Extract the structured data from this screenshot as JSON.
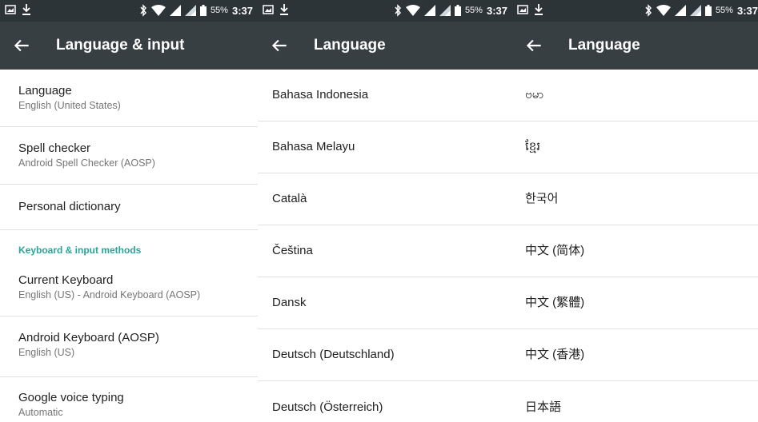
{
  "status": {
    "battery_text": "55%",
    "clock": "3:37"
  },
  "screen1": {
    "title": "Language & input",
    "items": [
      {
        "primary": "Language",
        "secondary": "English (United States)"
      },
      {
        "primary": "Spell checker",
        "secondary": "Android Spell Checker (AOSP)"
      },
      {
        "primary": "Personal dictionary"
      },
      {
        "primary": "Current Keyboard",
        "secondary": "English (US) - Android Keyboard (AOSP)"
      },
      {
        "primary": "Android Keyboard (AOSP)",
        "secondary": "English (US)"
      },
      {
        "primary": "Google voice typing",
        "secondary": "Automatic"
      }
    ],
    "category": "Keyboard & input methods"
  },
  "screen2": {
    "title": "Language",
    "items": [
      "Bahasa Indonesia",
      "Bahasa Melayu",
      "Català",
      "Čeština",
      "Dansk",
      "Deutsch (Deutschland)",
      "Deutsch (Österreich)"
    ]
  },
  "screen3": {
    "title": "Language",
    "items": [
      "ဗမာ",
      "ខ្មែរ",
      "한국어",
      "中文 (简体)",
      "中文 (繁體)",
      "中文 (香港)",
      "日本語"
    ]
  },
  "colors": {
    "statusbar": "#2d3438",
    "appbar": "#373f43",
    "accent": "#26a69a",
    "divider": "#e0e0e0"
  },
  "icons": {
    "status_left": [
      "screenshot-icon",
      "download-icon"
    ],
    "status_right": [
      "bluetooth-icon",
      "wifi-icon",
      "signal-icon",
      "signal-icon",
      "battery-icon"
    ],
    "back": "back-arrow-icon"
  }
}
